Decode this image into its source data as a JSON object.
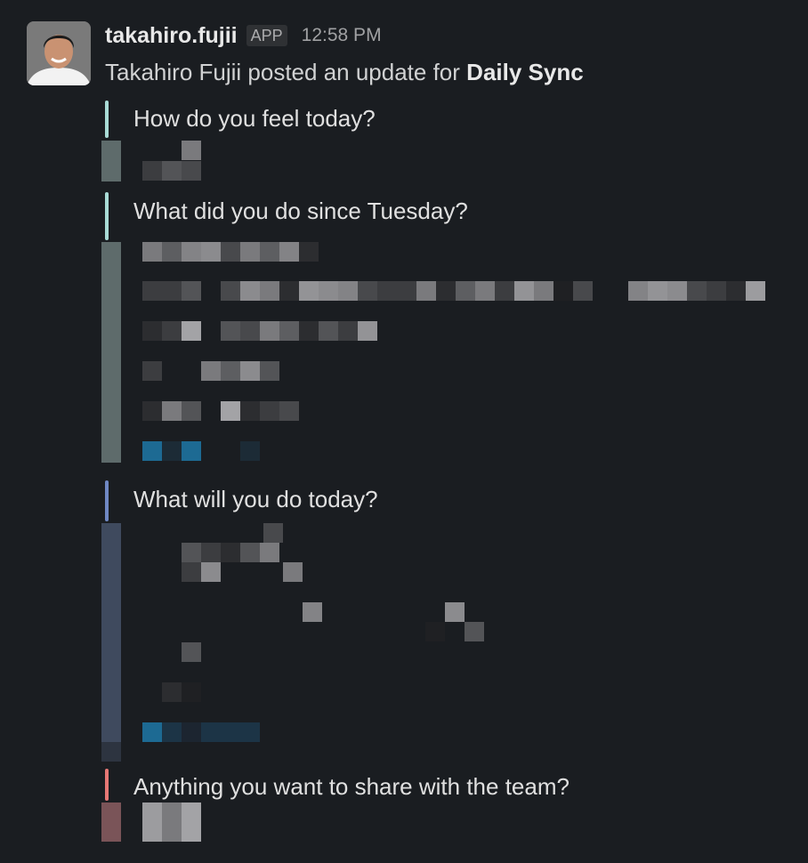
{
  "message": {
    "username": "takahiro.fujii",
    "badge": "APP",
    "time": "12:58 PM",
    "author": "Takahiro Fujii",
    "action": "posted an update for",
    "channel": "Daily Sync"
  },
  "questions": [
    {
      "title": "How do you feel today?",
      "color": "#a9dbd6"
    },
    {
      "title": "What did you do since Tuesday?",
      "color": "#a9dbd6"
    },
    {
      "title": "What will you do today?",
      "color": "#6f88c4"
    },
    {
      "title": "Anything you want to share with the team?",
      "color": "#e67875"
    }
  ]
}
